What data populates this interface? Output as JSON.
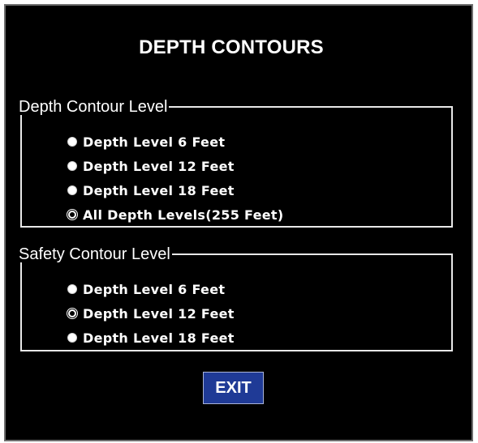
{
  "dialog": {
    "title": "DEPTH CONTOURS"
  },
  "depth_contour_group": {
    "legend": "Depth Contour Level",
    "options": [
      {
        "label": "Depth Level 6 Feet",
        "checked": false
      },
      {
        "label": "Depth Level 12 Feet",
        "checked": false
      },
      {
        "label": "Depth Level 18 Feet",
        "checked": false
      },
      {
        "label": "All Depth Levels(255 Feet)",
        "checked": true
      }
    ]
  },
  "safety_contour_group": {
    "legend": "Safety Contour Level",
    "options": [
      {
        "label": "Depth Level 6 Feet",
        "checked": false
      },
      {
        "label": "Depth Level 12 Feet",
        "checked": true
      },
      {
        "label": "Depth Level 18 Feet",
        "checked": false
      }
    ]
  },
  "buttons": {
    "exit_label": "EXIT"
  },
  "colors": {
    "background": "#000000",
    "text": "#ffffff",
    "exit_button": "#1f3a96",
    "border": "#e8e8e8"
  }
}
